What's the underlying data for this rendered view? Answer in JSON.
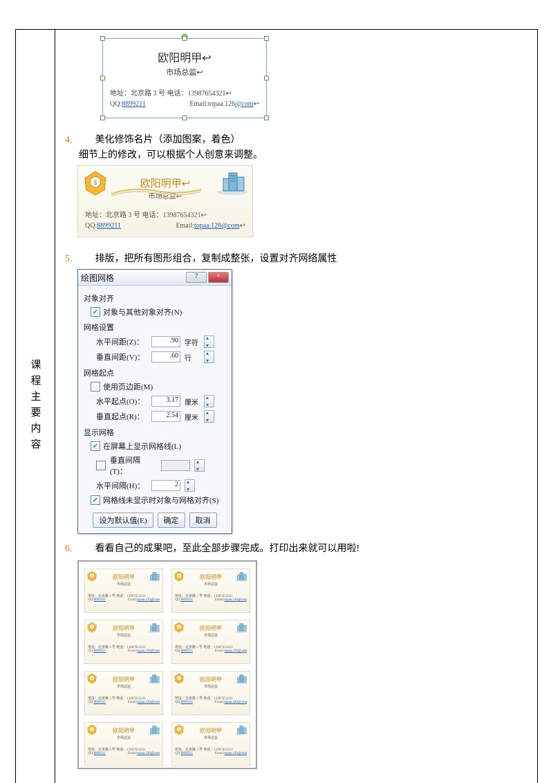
{
  "sidebar": {
    "label": "课程主要内容"
  },
  "card": {
    "name": "欧阳明甲",
    "title": "市场总监",
    "addr_label": "地址：北京路 3 号",
    "tel_label": "电话：",
    "tel": "13987654321",
    "qq_label": "QQ:",
    "qq": "8899211",
    "email_label": "Email:",
    "email_main": "topaa.126",
    "email_suffix": "@com",
    "email_full": "topaa.126@com"
  },
  "steps": {
    "s4_num": "4.",
    "s4_main": "美化修饰名片（添加图案，着色）",
    "s4_sub": "细节上的修改，可以根据个人创意来调整。",
    "s5_num": "5.",
    "s5_main": "排版，把所有图形组合，复制成整张，设置对齐网络属性",
    "s6_num": "6.",
    "s6_main": "看看自己的成果吧，至此全部步骤完成。打印出来就可以用啦!"
  },
  "dialog": {
    "title": "绘图网格",
    "help_btn": "?",
    "close_btn": "×",
    "sec_align": "对象对齐",
    "chk_align": "对象与其他对象对齐(N)",
    "sec_grid": "网格设置",
    "h_spacing_lbl": "水平间距(Z)：",
    "h_spacing_val": ".90",
    "h_spacing_unit": "字符",
    "v_spacing_lbl": "垂直间距(V)：",
    "v_spacing_val": ".60",
    "v_spacing_unit": "行",
    "sec_origin": "网格起点",
    "chk_margin": "使用页边距(M)",
    "h_origin_lbl": "水平起点(O)：",
    "h_origin_val": "3.17",
    "h_origin_unit": "厘米",
    "v_origin_lbl": "垂直起点(R)：",
    "v_origin_val": "2.54",
    "v_origin_unit": "厘米",
    "sec_show": "显示网格",
    "chk_showgrid": "在屏幕上显示网格线(L)",
    "chk_v_interval": "垂直间隔(T)：",
    "h_interval_lbl": "水平间隔(H)：",
    "h_interval_val": "2",
    "chk_snap": "网格线未显示时对象与网格对齐(S)",
    "btn_default": "设为默认值(E)",
    "btn_ok": "确定",
    "btn_cancel": "取消"
  }
}
